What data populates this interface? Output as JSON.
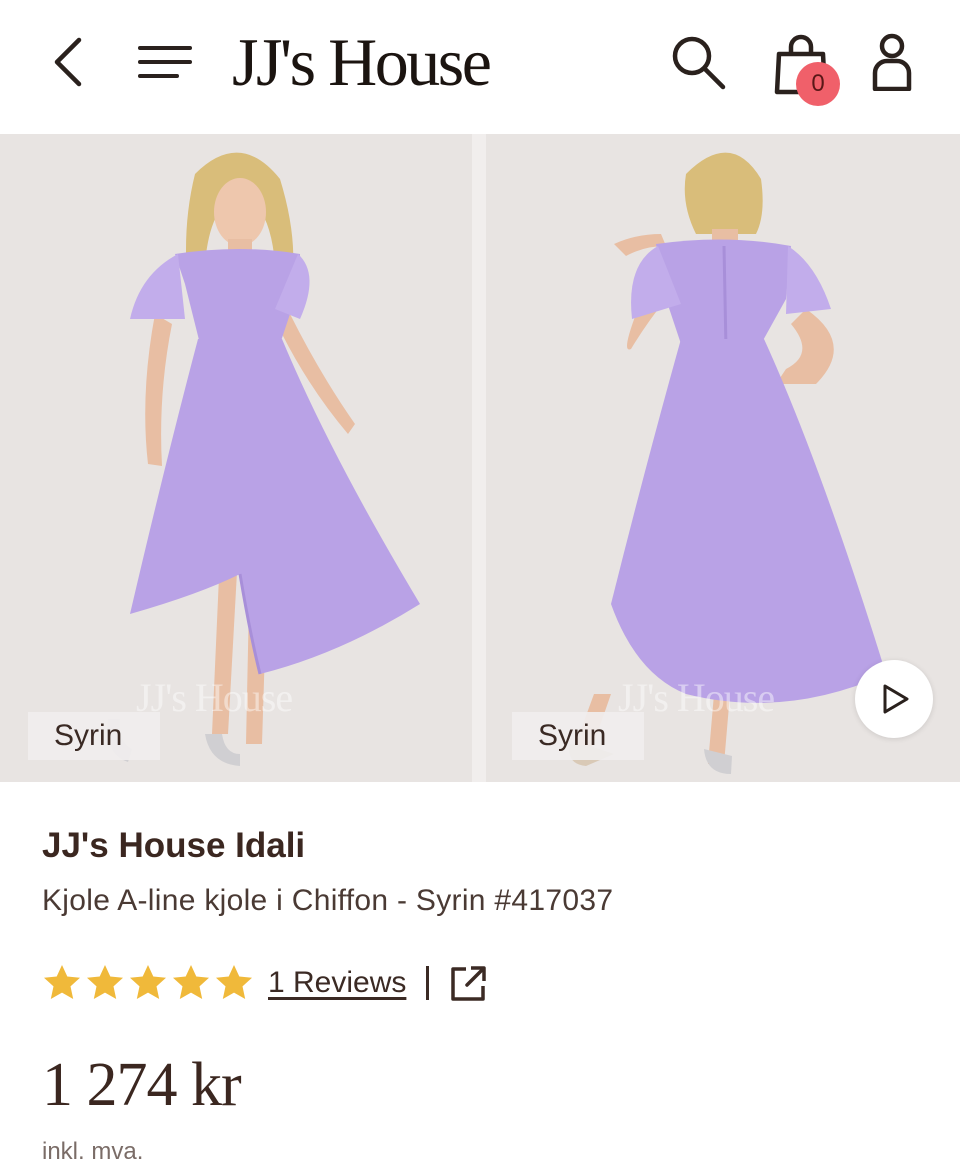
{
  "header": {
    "logo": "JJ's House",
    "cart_count": "0",
    "icons": {
      "back": "chevron-left-icon",
      "menu": "hamburger-menu-icon",
      "search": "search-icon",
      "cart": "shopping-bag-icon",
      "account": "user-icon"
    }
  },
  "gallery": {
    "images": [
      {
        "color_label": "Syrin",
        "watermark": "JJ's House",
        "view": "front"
      },
      {
        "color_label": "Syrin",
        "watermark": "JJ's House",
        "view": "back"
      }
    ],
    "play_icon": "play-icon"
  },
  "product": {
    "brand": "JJ's House Idali",
    "subtitle": "Kjole A-line kjole i Chiffon - Syrin #417037",
    "rating_stars": 5,
    "reviews_label": "1 Reviews",
    "price": "1 274 kr",
    "tax_note": "inkl. mva."
  },
  "colors": {
    "dress": "#b9a2e6",
    "star": "#f0b93a",
    "badge": "#f0606a",
    "text": "#3b2720"
  }
}
